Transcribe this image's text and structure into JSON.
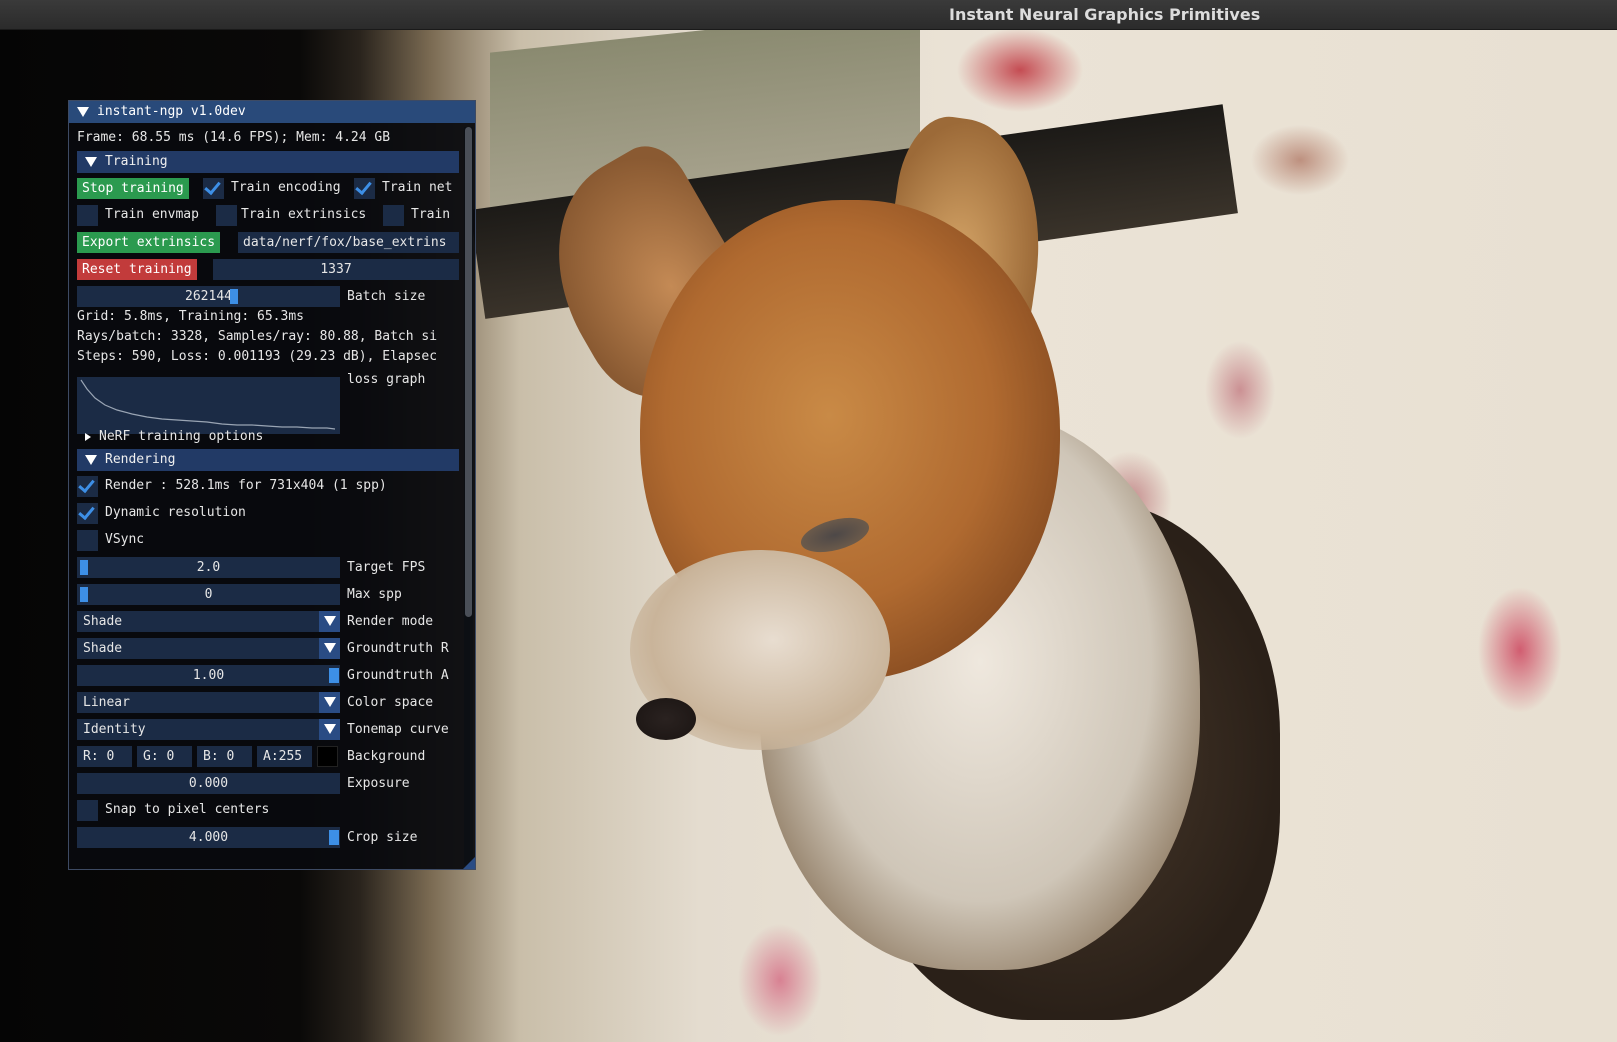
{
  "window": {
    "title": "Instant Neural Graphics Primitives"
  },
  "panel": {
    "title": "instant-ngp v1.0dev",
    "frame_info": "Frame: 68.55 ms (14.6 FPS); Mem: 4.24 GB",
    "training": {
      "header": "Training",
      "stop_button": "Stop training",
      "train_encoding": {
        "label": "Train encoding",
        "checked": true
      },
      "train_net": {
        "label": "Train net",
        "checked": true
      },
      "train_envmap": {
        "label": "Train envmap",
        "checked": false
      },
      "train_extrinsics": {
        "label": "Train extrinsics",
        "checked": false
      },
      "train_extra": {
        "label": "Train",
        "checked": false
      },
      "export_button": "Export extrinsics",
      "export_path": "data/nerf/fox/base_extrins",
      "reset_button": "Reset training",
      "seed_value": "1337",
      "batch_size_value": "262144",
      "batch_size_label": "Batch size",
      "stats_line1": "Grid: 5.8ms, Training: 65.3ms",
      "stats_line2": "Rays/batch: 3328, Samples/ray: 80.88, Batch si",
      "stats_line3": "Steps: 590, Loss: 0.001193 (29.23 dB), Elapsec",
      "loss_graph_label": "loss graph",
      "nerf_options": "NeRF training options"
    },
    "rendering": {
      "header": "Rendering",
      "render": {
        "label": "Render : 528.1ms for 731x404 (1 spp)",
        "checked": true
      },
      "dynamic_resolution": {
        "label": "Dynamic resolution",
        "checked": true
      },
      "vsync": {
        "label": "VSync",
        "checked": false
      },
      "target_fps": {
        "value": "2.0",
        "label": "Target FPS"
      },
      "max_spp": {
        "value": "0",
        "label": "Max spp"
      },
      "render_mode": {
        "value": "Shade",
        "label": "Render mode"
      },
      "groundtruth_render": {
        "value": "Shade",
        "label": "Groundtruth R"
      },
      "groundtruth_alpha": {
        "value": "1.00",
        "label": "Groundtruth A"
      },
      "color_space": {
        "value": "Linear",
        "label": "Color space"
      },
      "tonemap_curve": {
        "value": "Identity",
        "label": "Tonemap curve"
      },
      "background": {
        "r": "R:   0",
        "g": "G:   0",
        "b": "B:   0",
        "a": "A:255",
        "label": "Background",
        "swatch": "#000000"
      },
      "exposure": {
        "value": "0.000",
        "label": "Exposure"
      },
      "snap_pixel": {
        "label": "Snap to pixel centers",
        "checked": false
      },
      "crop_size": {
        "value": "4.000",
        "label": "Crop size"
      }
    }
  },
  "colors": {
    "title_bg": "#294a7a",
    "header_bg": "#223a66",
    "frame_bg": "#1b2b45",
    "accent": "#3d8fe6",
    "button_green": "#2b9a4f",
    "button_red": "#c23b3b"
  },
  "icons": [
    "collapse-triangle-icon",
    "expand-triangle-icon",
    "checkmark-icon",
    "combo-arrow-icon"
  ]
}
